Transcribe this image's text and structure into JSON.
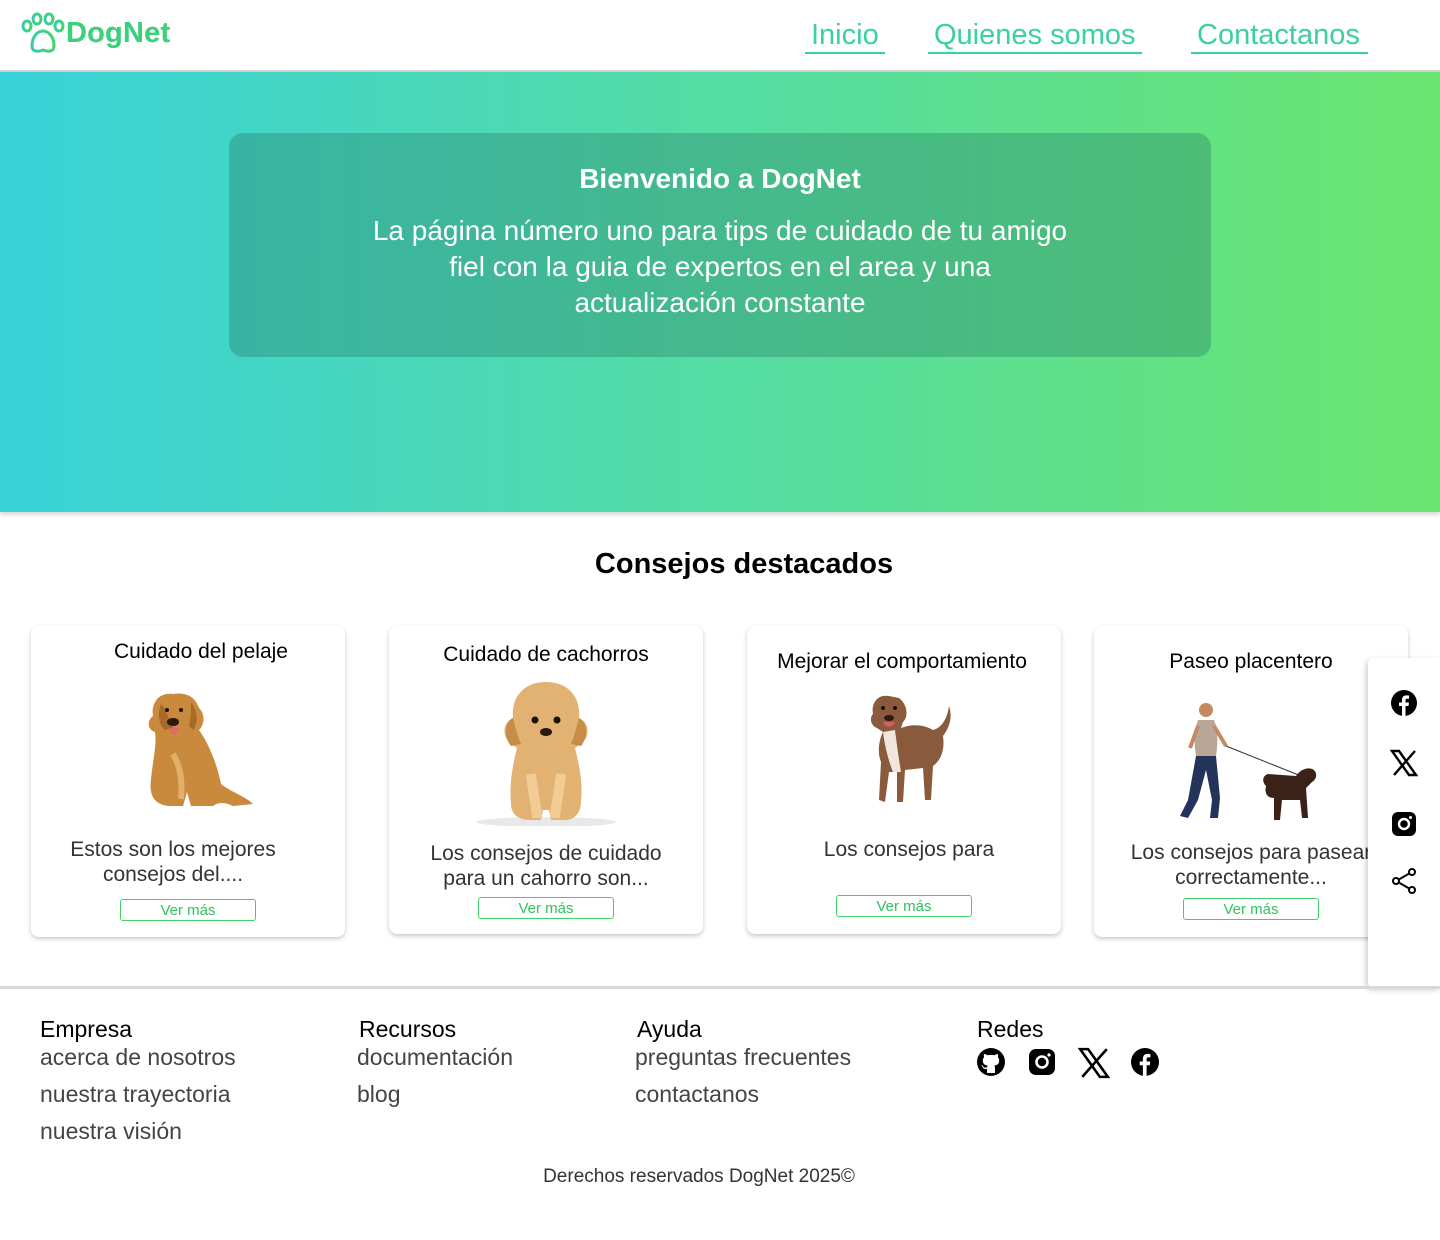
{
  "header": {
    "brand": "DogNet",
    "nav": [
      {
        "label": "Inicio"
      },
      {
        "label": "Quienes somos"
      },
      {
        "label": "Contactanos"
      }
    ]
  },
  "hero": {
    "title": "Bienvenido a DogNet",
    "text": "La página número uno para tips de cuidado de tu amigo fiel con la guia de expertos en el area y una actualización constante"
  },
  "featured": {
    "title": "Consejos destacados",
    "cards": [
      {
        "title": "Cuidado del pelaje",
        "desc": "Estos son los mejores consejos del....",
        "button": "Ver más",
        "image": "golden-retriever-sitting-photo"
      },
      {
        "title": "Cuidado de cachorros",
        "desc": "Los consejos de cuidado para un cahorro son...",
        "button": "Ver más",
        "image": "golden-puppy-photo"
      },
      {
        "title": "Mejorar el comportamiento",
        "desc": "Los consejos para",
        "button": "Ver más",
        "image": "pitbull-standing-photo"
      },
      {
        "title": "Paseo placentero",
        "desc": "Los consejos para pasear correctamente...",
        "button": "Ver más",
        "image": "man-walking-dog-photo"
      }
    ]
  },
  "share_panel": {
    "icons": [
      "facebook-icon",
      "x-icon",
      "instagram-icon",
      "share-icon"
    ]
  },
  "footer": {
    "columns": [
      {
        "title": "Empresa",
        "links": [
          "acerca de nosotros",
          "nuestra trayectoria",
          "nuestra visión"
        ]
      },
      {
        "title": "Recursos",
        "links": [
          "documentación",
          "blog"
        ]
      },
      {
        "title": "Ayuda",
        "links": [
          "preguntas frecuentes",
          "contactanos"
        ]
      },
      {
        "title": "Redes",
        "icons": [
          "github-icon",
          "instagram-icon",
          "x-icon",
          "facebook-icon"
        ]
      }
    ],
    "copyright": "Derechos reservados DogNet 2025©"
  },
  "colors": {
    "brand_green": "#3fd66b",
    "nav_teal": "#39d29a",
    "hero_start": "#38d2d9",
    "hero_end": "#69e570"
  }
}
